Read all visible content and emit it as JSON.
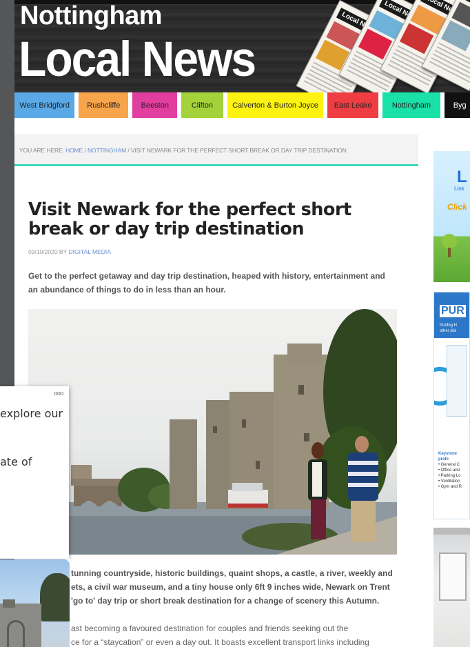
{
  "header": {
    "logo_line1": "Nottingham",
    "logo_line2": "Local News",
    "papers": [
      {
        "title": "Local News"
      },
      {
        "title": "Local News"
      },
      {
        "title": "Local News"
      },
      {
        "title": "Local News"
      }
    ]
  },
  "nav": {
    "items": [
      {
        "label": "West Bridgford",
        "color": "#5aa9e6"
      },
      {
        "label": "Rushcliffe",
        "color": "#f7a44a"
      },
      {
        "label": "Beeston",
        "color": "#e23ea0"
      },
      {
        "label": "Clifton",
        "color": "#a4d23b"
      },
      {
        "label": "Calverton & Burton Joyce",
        "color": "#fef212"
      },
      {
        "label": "East Leake",
        "color": "#f03c43"
      },
      {
        "label": "Nottingham",
        "color": "#19e1a7"
      },
      {
        "label": "Byg",
        "color": "#111111"
      }
    ]
  },
  "breadcrumb": {
    "prefix": "YOU ARE HERE:",
    "home": "HOME",
    "sep1": "/",
    "section": "NOTTINGHAM",
    "sep2": "/",
    "current": "VISIT NEWARK FOR THE PERFECT SHORT BREAK OR DAY TRIP DESTINATION"
  },
  "article": {
    "title": "Visit Newark for the perfect short break or day trip destination",
    "date": "09/10/2020",
    "by": "BY",
    "author": "DIGITAL MEDIA",
    "lead": "Get to the perfect getaway and day trip destination, heaped with history, entertainment and an abundance of things to do in less than an hour.",
    "body_lines": [
      "tunning countryside, historic buildings, quaint shops, a castle, a river, weekly and",
      "ets, a civil war museum, and a tiny house only 6ft 9 inches wide, Newark on Trent",
      "'go to' day trip or short break destination for a change of scenery this Autumn."
    ],
    "body_lines_2": [
      "ast becoming a favoured destination for couples and friends seeking out the",
      "ce for a “staycation” or even a day out. It boasts excellent transport links including"
    ]
  },
  "sidebar": {
    "ad1": {
      "big": "L",
      "small": "Link",
      "click": "Click"
    },
    "ad2": {
      "brand": "PUR",
      "subtitle_1": "Purifog H",
      "subtitle_2": "other disi",
      "list_head": "Keystone",
      "list_sub": "profe",
      "list_items": [
        "• General C",
        "• Office and",
        "• Parking Lo",
        "• Ventilation",
        "• Gym and R"
      ]
    }
  },
  "overlay": {
    "menu_dots": "ooo",
    "line1": "explore our",
    "line2": "ate of"
  }
}
